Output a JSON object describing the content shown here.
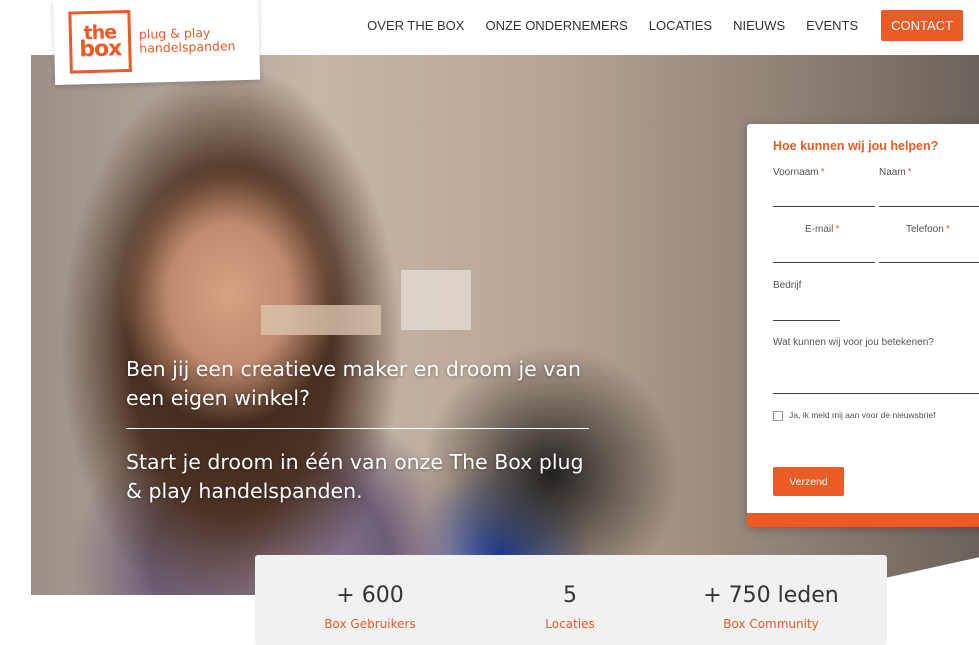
{
  "brand": {
    "logo_line1": "the",
    "logo_line2": "box",
    "tagline_line1": "plug & play",
    "tagline_line2": "handelspanden",
    "accent_color": "#ea5b25"
  },
  "nav": {
    "items": [
      "OVER THE BOX",
      "ONZE ONDERNEMERS",
      "LOCATIES",
      "NIEUWS",
      "EVENTS"
    ],
    "cta": "CONTACT"
  },
  "hero": {
    "headline": "Ben jij een creatieve maker en droom je van een eigen winkel?",
    "subline": "Start je droom in één van onze The Box plug & play handelspanden."
  },
  "form": {
    "title": "Hoe kunnen wij jou helpen?",
    "fields": {
      "voornaam": "Voornaam",
      "naam": "Naam",
      "email": "E-mail",
      "telefoon": "Telefoon",
      "bedrijf": "Bedrijf",
      "bericht": "Wat kunnen wij voor jou betekenen?"
    },
    "required_mark": "*",
    "newsletter_label": "Ja, ik meld mij aan voor de nieuwsbrief",
    "submit_label": "Verzend"
  },
  "stats": [
    {
      "value": "+ 600",
      "label": "Box Gebruikers"
    },
    {
      "value": "5",
      "label": "Locaties"
    },
    {
      "value": "+ 750 leden",
      "label": "Box Community"
    }
  ]
}
